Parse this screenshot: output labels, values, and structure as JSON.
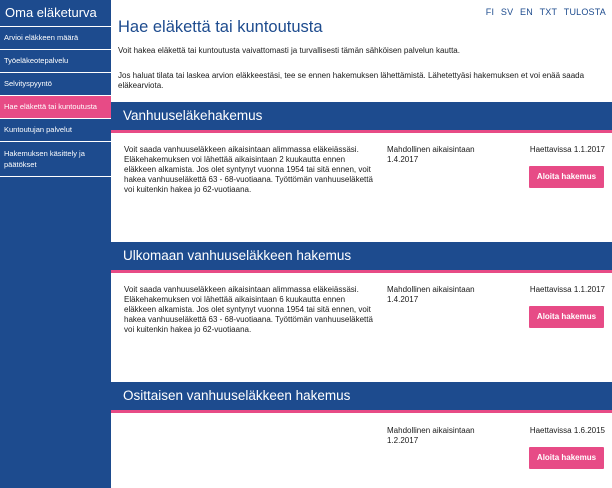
{
  "sidebar": {
    "title": "Oma eläketurva",
    "items": [
      {
        "label": "Arvioi eläkkeen määrä"
      },
      {
        "label": "Työeläkeotepalvelu"
      },
      {
        "label": "Selvityspyyntö"
      },
      {
        "label": "Hae eläkettä tai kuntoutusta"
      },
      {
        "label": "Kuntoutujan palvelut"
      },
      {
        "label": "Hakemuksen käsittely ja päätökset"
      }
    ]
  },
  "topnav": {
    "fi": "FI",
    "sv": "SV",
    "en": "EN",
    "txt": "TXT",
    "print": "TULOSTA"
  },
  "page": {
    "title": "Hae eläkettä tai kuntoutusta",
    "intro1": "Voit hakea eläkettä tai kuntoutusta vaivattomasti ja turvallisesti tämän sähköisen palvelun kautta.",
    "intro2": "Jos haluat tilata tai laskea arvion eläkkeestäsi, tee se ennen hakemuksen lähettämistä. Lähetettyäsi hakemuksen et voi enää saada eläkearviota."
  },
  "sections": [
    {
      "title": "Vanhuuseläkehakemus",
      "description": "Voit saada vanhuuseläkkeen aikaisintaan alimmassa eläkeiässäsi. Eläkehakemuksen voi lähettää aikaisintaan 2 kuukautta ennen eläkkeen alkamista. Jos olet syntynyt vuonna 1954 tai sitä ennen, voit hakea vanhuuseläkettä 63 - 68-vuotiaana. Työttömän vanhuuseläkettä voi kuitenkin hakea jo 62-vuotiaana.",
      "earliest": "Mahdollinen aikaisintaan 1.4.2017",
      "applicable": "Haettavissa 1.1.2017",
      "button": "Aloita hakemus"
    },
    {
      "title": "Ulkomaan vanhuuseläkkeen hakemus",
      "description": "Voit saada vanhuuseläkkeen aikaisintaan alimmassa eläkeiässäsi. Eläkehakemuksen voi lähettää aikaisintaan 6 kuukautta ennen eläkkeen alkamista. Jos olet syntynyt vuonna 1954 tai sitä ennen, voit hakea vanhuuseläkettä 63 - 68-vuotiaana. Työttömän vanhuuseläkettä voi kuitenkin hakea jo 62-vuotiaana.",
      "earliest": "Mahdollinen aikaisintaan 1.4.2017",
      "applicable": "Haettavissa 1.1.2017",
      "button": "Aloita hakemus"
    },
    {
      "title": "Osittaisen vanhuuseläkkeen hakemus",
      "description": "",
      "earliest": "Mahdollinen aikaisintaan 1.2.2017",
      "applicable": "Haettavissa 1.6.2015",
      "button": "Aloita hakemus"
    }
  ],
  "colors": {
    "brand_blue": "#1d4b8e",
    "accent_pink": "#e74b86"
  }
}
